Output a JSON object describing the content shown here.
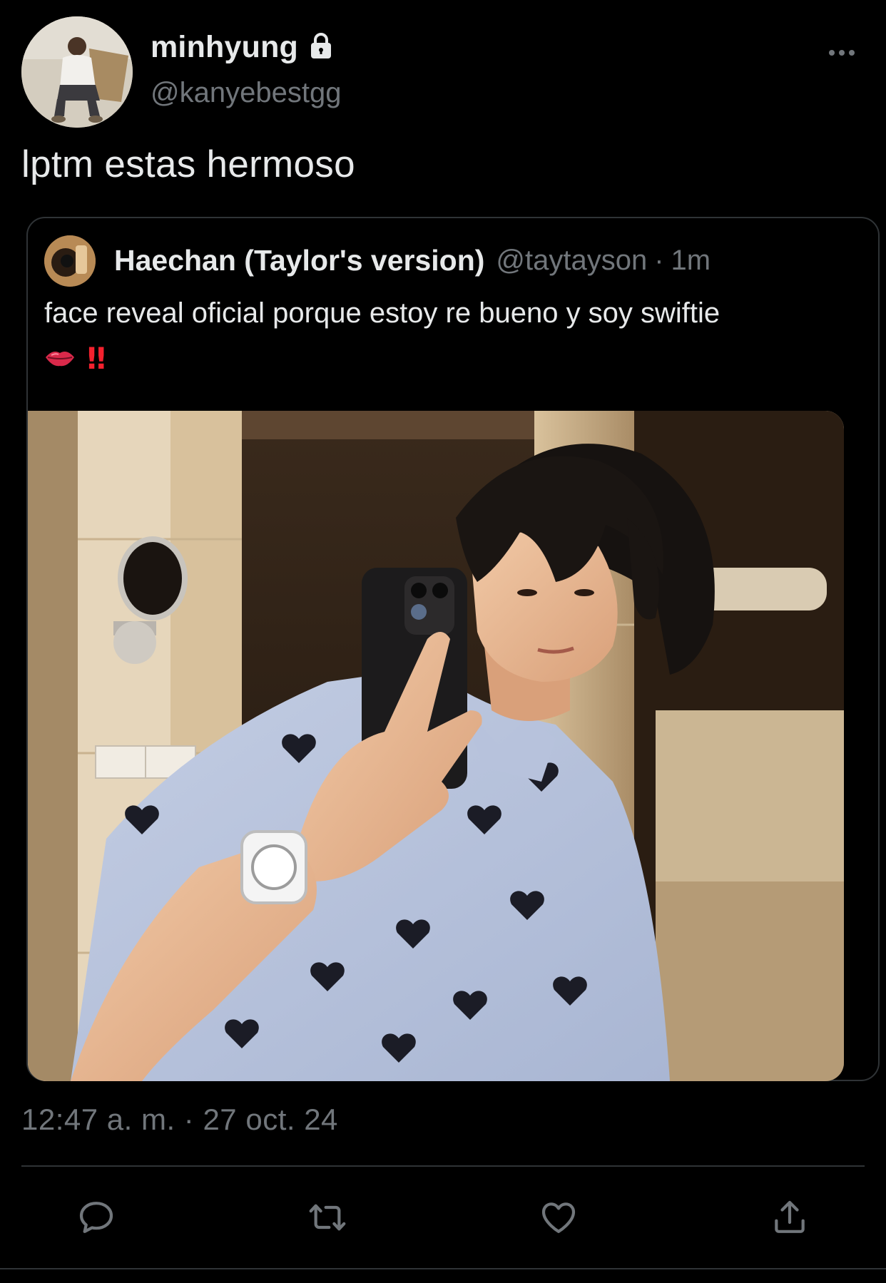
{
  "author": {
    "display_name": "minhyung",
    "handle": "@kanyebestgg",
    "protected_icon": "lock-icon",
    "avatar": "profile-photo"
  },
  "tweet": {
    "text": "lptm estas hermoso",
    "timestamp": "12:47 a. m. · 27 oct. 24"
  },
  "quoted_tweet": {
    "display_name": "Haechan (Taylor's version)",
    "handle": "@taytayson",
    "separator": "·",
    "time": "1m",
    "text": "face reveal oficial porque estoy re bueno y soy swiftie",
    "emojis": [
      "lips-emoji",
      "double-exclamation-emoji"
    ],
    "emoji_text": "‼",
    "media": "selfie-photo"
  },
  "actions": {
    "icons": [
      "reply-icon",
      "retweet-icon",
      "like-icon",
      "share-icon"
    ]
  },
  "colors": {
    "background": "#000000",
    "text_primary": "#e7e9ea",
    "text_secondary": "#71767b",
    "border": "#2f3336",
    "accent_red": "#f4212e"
  }
}
